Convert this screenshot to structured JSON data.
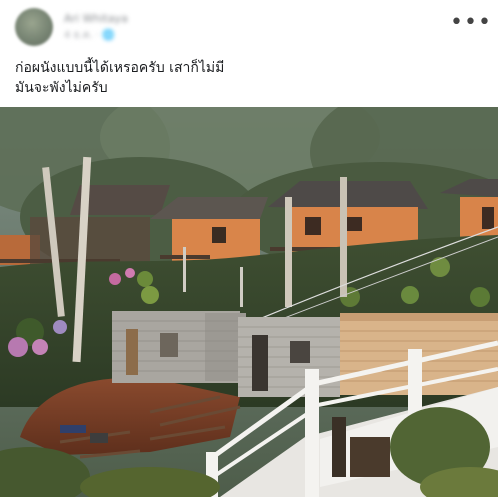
{
  "post": {
    "author_name": "Ari Whitaya",
    "meta": "4 ธ.ค. · 🌐",
    "more_icon": "more-horizontal-icon",
    "more_glyph": "•••",
    "caption_lines": [
      "ก่อผนังแบบนี้ได้เหรอครับ เสาก็ไม่มี",
      "มันจะพังไม่ครับ"
    ]
  },
  "photo": {
    "subject": "hillside-construction-photo"
  }
}
